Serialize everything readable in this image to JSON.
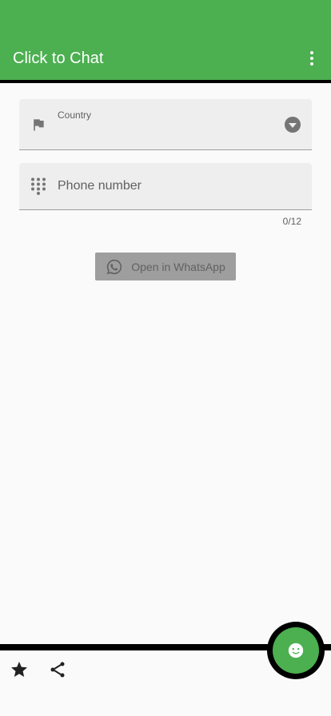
{
  "app_bar": {
    "title": "Click to Chat",
    "background": "#4caf50",
    "menu_icon": "more-vert-icon"
  },
  "country_field": {
    "label": "Country",
    "value": "",
    "icon": "flag-icon",
    "dropdown_icon": "dropdown-arrow-icon"
  },
  "phone_field": {
    "placeholder": "Phone number",
    "value": "",
    "icon": "dialpad-icon",
    "counter": "0/12"
  },
  "open_button": {
    "label": "Open in WhatsApp",
    "icon": "whatsapp-icon",
    "enabled": false
  },
  "bottom_bar": {
    "star_icon": "star-icon",
    "share_icon": "share-icon",
    "fab_icon": "smiley-icon",
    "accent": "#4caf50"
  }
}
